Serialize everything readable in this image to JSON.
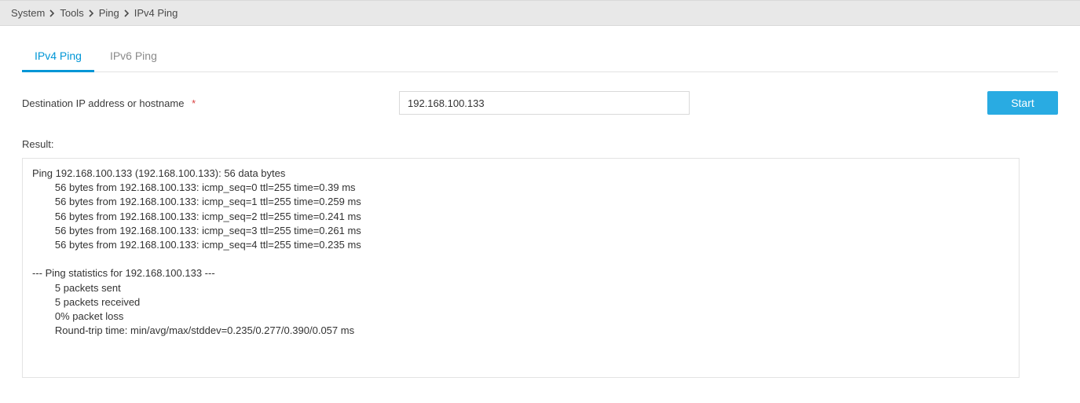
{
  "breadcrumb": {
    "items": [
      "System",
      "Tools",
      "Ping",
      "IPv4 Ping"
    ]
  },
  "tabs": [
    {
      "label": "IPv4 Ping",
      "active": true
    },
    {
      "label": "IPv6 Ping",
      "active": false
    }
  ],
  "form": {
    "destination_label": "Destination IP address or hostname",
    "destination_value": "192.168.100.133",
    "start_label": "Start"
  },
  "result": {
    "label": "Result:",
    "text": "Ping 192.168.100.133 (192.168.100.133): 56 data bytes\n        56 bytes from 192.168.100.133: icmp_seq=0 ttl=255 time=0.39 ms\n        56 bytes from 192.168.100.133: icmp_seq=1 ttl=255 time=0.259 ms\n        56 bytes from 192.168.100.133: icmp_seq=2 ttl=255 time=0.241 ms\n        56 bytes from 192.168.100.133: icmp_seq=3 ttl=255 time=0.261 ms\n        56 bytes from 192.168.100.133: icmp_seq=4 ttl=255 time=0.235 ms\n\n--- Ping statistics for 192.168.100.133 ---\n        5 packets sent\n        5 packets received\n        0% packet loss\n        Round-trip time: min/avg/max/stddev=0.235/0.277/0.390/0.057 ms"
  }
}
